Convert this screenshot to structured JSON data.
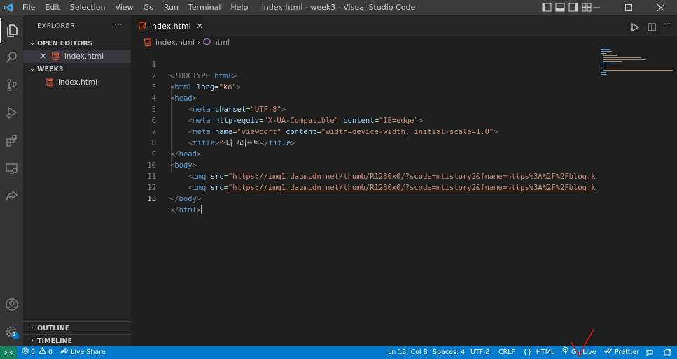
{
  "titlebar": {
    "menu": [
      "File",
      "Edit",
      "Selection",
      "View",
      "Go",
      "Run",
      "Terminal",
      "Help"
    ],
    "title": "index.html - week3 - Visual Studio Code"
  },
  "sidebar": {
    "header": "EXPLORER",
    "open_editors": "OPEN EDITORS",
    "open_file": "index.html",
    "folder": "WEEK3",
    "folder_file": "index.html",
    "outline": "OUTLINE",
    "timeline": "TIMELINE"
  },
  "editor": {
    "tab_label": "index.html",
    "breadcrumb_file": "index.html",
    "breadcrumb_symbol": "html",
    "line_numbers": [
      "1",
      "2",
      "3",
      "4",
      "5",
      "6",
      "7",
      "8",
      "9",
      "10",
      "11",
      "12",
      "13"
    ],
    "lines": [
      [
        "<!DOCTYPE ",
        "html",
        ">"
      ],
      [
        "<",
        "html",
        " ",
        "lang",
        "=",
        "\"ko\"",
        ">"
      ],
      [
        "<",
        "head",
        ">"
      ],
      [
        "<",
        "meta",
        " ",
        "charset",
        "=",
        "\"UTF-8\"",
        ">"
      ],
      [
        "<",
        "meta",
        " ",
        "http-equiv",
        "=",
        "\"X-UA-Compatible\"",
        " ",
        "content",
        "=",
        "\"IE=edge\"",
        ">"
      ],
      [
        "<",
        "meta",
        " ",
        "name",
        "=",
        "\"viewport\"",
        " ",
        "content",
        "=",
        "\"width=device-width, initial-scale=1.0\"",
        ">"
      ],
      [
        "<",
        "title",
        ">",
        "스타크래프트",
        "</",
        "title",
        ">"
      ],
      [
        "</",
        "head",
        ">"
      ],
      [
        "<",
        "body",
        ">"
      ],
      [
        "<",
        "img",
        " ",
        "src",
        "=",
        "\"https://img1.daumcdn.net/thumb/R1280x0/?scode=mtistory2&fname=https%3A%2F%2Fblog.k"
      ],
      [
        "<",
        "img",
        " ",
        "src",
        "=",
        "\"https://img1.daumcdn.net/thumb/R1280x0/?scode=mtistory2&fname=https%3A%2F%2Fblog.k"
      ],
      [
        "</",
        "body",
        ">"
      ],
      [
        "</",
        "html",
        ">"
      ]
    ]
  },
  "status": {
    "errors": "0",
    "warnings": "0",
    "live_share": "Live Share",
    "position": "Ln 13, Col 8",
    "spaces": "Spaces: 4",
    "encoding": "UTF-8",
    "eol": "CRLF",
    "language": "HTML",
    "go_live": "Go Live",
    "prettier": "Prettier",
    "badge": "1"
  },
  "colors": {
    "accent": "#007acc",
    "html_icon": "#e44d26",
    "remote": "#16825d",
    "annotation": "#e51400"
  }
}
